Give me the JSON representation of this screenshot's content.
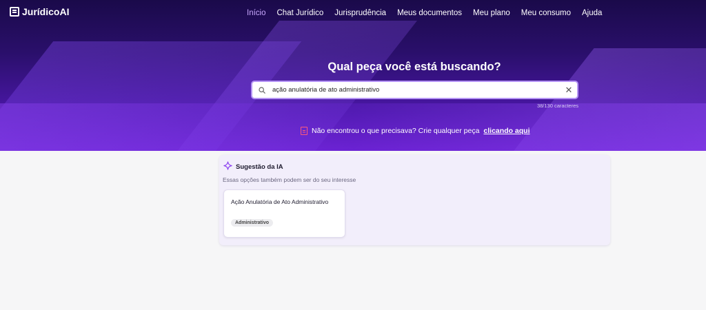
{
  "app": {
    "name": "JurídicoAI"
  },
  "nav": {
    "items": [
      {
        "label": "Início",
        "active": true
      },
      {
        "label": "Chat Jurídico"
      },
      {
        "label": "Jurisprudência"
      },
      {
        "label": "Meus documentos"
      },
      {
        "label": "Meu plano"
      },
      {
        "label": "Meu consumo"
      },
      {
        "label": "Ajuda"
      }
    ]
  },
  "hero": {
    "title": "Qual peça você está buscando?",
    "search_value": "ação anulatória de ato administrativo",
    "char_count": "38/130 caracteres",
    "not_found_text": "Não encontrou o que precisava? Crie qualquer peça",
    "not_found_link": "clicando aqui"
  },
  "suggestions": {
    "title": "Sugestão da IA",
    "subtitle": "Essas opções também podem ser do seu interesse",
    "cards": [
      {
        "title": "Ação Anulatória de Ato Administrativo",
        "tag": "Administrativo"
      }
    ]
  },
  "colors": {
    "hero_dark": "#1a0a4a",
    "hero_purple": "#6a20d0",
    "accent": "#c9a8ff",
    "panel_bg": "#f2eefb",
    "alert_icon": "#ff5a7a"
  },
  "icons": {
    "logo": "document-lines-icon",
    "search": "search-icon",
    "clear": "close-icon",
    "alert": "document-alert-icon",
    "ai": "sparkle-icon"
  }
}
